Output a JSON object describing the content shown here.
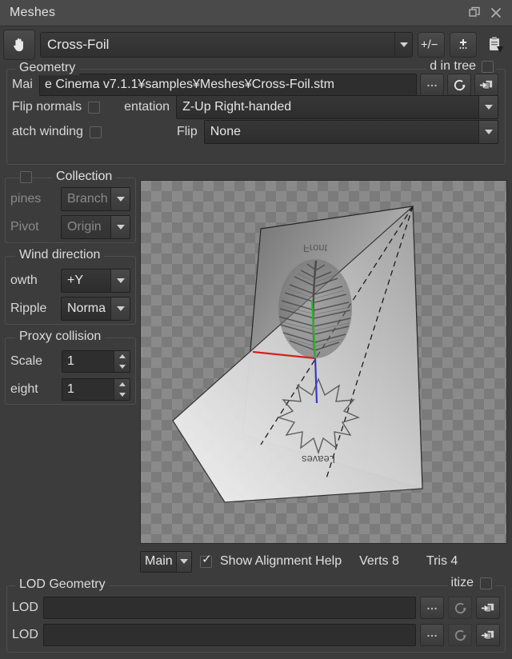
{
  "window": {
    "title": "Meshes",
    "float_icon": "restore-icon",
    "close_icon": "close-icon"
  },
  "toolbar": {
    "pan_tool_icon": "hand-icon",
    "asset_name": "Cross-Foil",
    "plus_minus_label": "+/-",
    "add_label": "+",
    "clipboard_icon": "clipboard-icon"
  },
  "geometry": {
    "title": "Geometry",
    "used_in_tree_label": "d in tree",
    "used_in_tree_checked": false,
    "main_label": "Mai",
    "main_path": "e Cinema v7.1.1¥samples¥Meshes¥Cross-Foil.stm",
    "browse_label": "...",
    "reload_icon": "reload-icon",
    "export_icon": "open-external-icon",
    "flip_normals_label": "Flip normals",
    "flip_normals_checked": false,
    "orientation_label": "entation",
    "orientation_value": "Z-Up Right-handed",
    "match_winding_label": "atch winding",
    "match_winding_checked": false,
    "flip_label": "Flip",
    "flip_value": "None"
  },
  "collection": {
    "title": "Collection",
    "enabled_checked": false,
    "spines_label": "pines",
    "spines_value": "Branch",
    "pivot_label": "Pivot",
    "pivot_value": "Origin"
  },
  "wind": {
    "title": "Wind direction",
    "growth_label": "owth",
    "growth_value": "+Y",
    "ripple_label": "Ripple",
    "ripple_value": "Norma"
  },
  "proxy": {
    "title": "Proxy collision",
    "scale_label": "Scale",
    "scale_value": "1",
    "height_label": "eight",
    "height_value": "1"
  },
  "viewport": {
    "front_label": "Front",
    "leaves_label": "Leaves"
  },
  "status": {
    "material_value": "Main",
    "alignment_label": "Show Alignment Help",
    "alignment_checked": true,
    "verts_label": "Verts 8",
    "tris_label": "Tris 4"
  },
  "lod": {
    "title": "LOD Geometry",
    "prioritize_label": "itize",
    "prioritize_checked": false,
    "rows": [
      {
        "label": "LOD",
        "path": "",
        "browse": "...",
        "reload_icon": "reload-icon",
        "export_icon": "open-external-icon"
      },
      {
        "label": "LOD",
        "path": "",
        "browse": "...",
        "reload_icon": "reload-icon",
        "export_icon": "open-external-icon"
      }
    ]
  },
  "colors": {
    "panel_bg": "#3c3c3c",
    "titlebar_bg": "#4a4a4a",
    "field_bg": "#2e2e2e",
    "axis_x": "#d32020",
    "axis_y": "#2bb32b",
    "axis_z": "#3838cc"
  }
}
